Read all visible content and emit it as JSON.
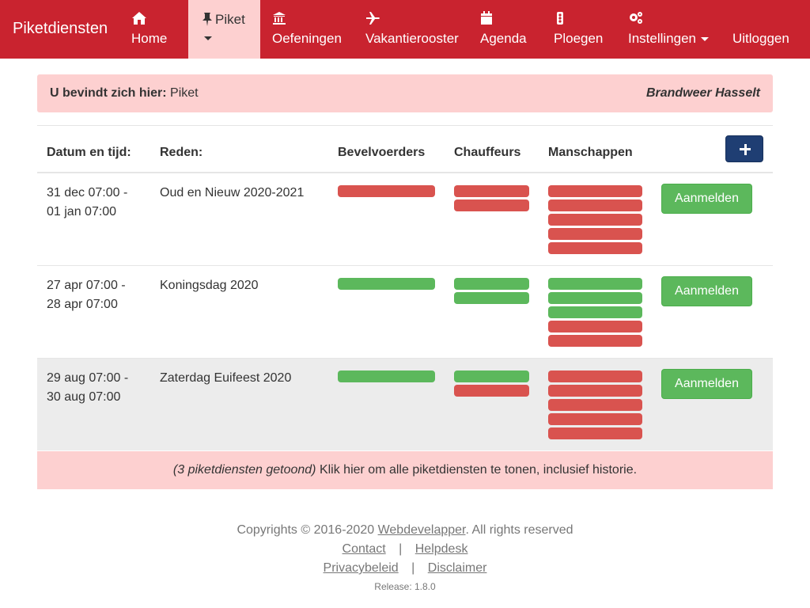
{
  "navbar": {
    "brand": "Piketdiensten",
    "items": [
      {
        "label": "Home",
        "icon": "home-icon"
      },
      {
        "label": "Piket",
        "icon": "pin-icon"
      },
      {
        "label": "Oefeningen",
        "icon": "bank-icon"
      },
      {
        "label": "Vakantierooster",
        "icon": "plane-icon"
      },
      {
        "label": "Agenda",
        "icon": "calendar-icon"
      },
      {
        "label": "Ploegen",
        "icon": "traffic-light-icon"
      },
      {
        "label": "Instellingen",
        "icon": "cogs-icon"
      },
      {
        "label": "Uitloggen",
        "icon": ""
      }
    ]
  },
  "breadcrumb": {
    "prefix": "U bevindt zich hier:",
    "current": "Piket",
    "organisation": "Brandweer Hasselt"
  },
  "table": {
    "headers": [
      "Datum en tijd:",
      "Reden:",
      "Bevelvoerders",
      "Chauffeurs",
      "Manschappen"
    ],
    "rows": [
      {
        "date_line1": "31 dec 07:00 -",
        "date_line2": "01 jan 07:00",
        "reason": "Oud en Nieuw 2020-2021",
        "bevelvoerders": [
          "red"
        ],
        "chauffeurs": [
          "red",
          "red"
        ],
        "manschappen": [
          "red",
          "red",
          "red",
          "red",
          "red"
        ],
        "button": "Aanmelden"
      },
      {
        "date_line1": "27 apr 07:00 -",
        "date_line2": "28 apr 07:00",
        "reason": "Koningsdag 2020",
        "bevelvoerders": [
          "green"
        ],
        "chauffeurs": [
          "green",
          "green"
        ],
        "manschappen": [
          "green",
          "green",
          "green",
          "red",
          "red"
        ],
        "button": "Aanmelden"
      },
      {
        "date_line1": "29 aug 07:00 -",
        "date_line2": "30 aug 07:00",
        "reason": "Zaterdag Euifeest 2020",
        "bevelvoerders": [
          "green"
        ],
        "chauffeurs": [
          "green",
          "red"
        ],
        "manschappen": [
          "red",
          "red",
          "red",
          "red",
          "red"
        ],
        "button": "Aanmelden"
      }
    ]
  },
  "note": {
    "count_text": "(3 piketdiensten getoond)",
    "link_text": "Klik hier om alle piketdiensten te tonen, inclusief historie."
  },
  "footer": {
    "copyright_prefix": "Copyrights © 2016-2020",
    "company": "Webdevelapper",
    "copyright_suffix": ". All rights reserved",
    "links": [
      "Contact",
      "Helpdesk",
      "Privacybeleid",
      "Disclaimer"
    ],
    "separator": "|",
    "release": "Release: 1.8.0"
  },
  "colors": {
    "navbar": "#c9232f",
    "active_tab": "#fdd0d0",
    "status_red": "#d9534f",
    "status_green": "#5cb85c",
    "add_button": "#1f3e73"
  }
}
